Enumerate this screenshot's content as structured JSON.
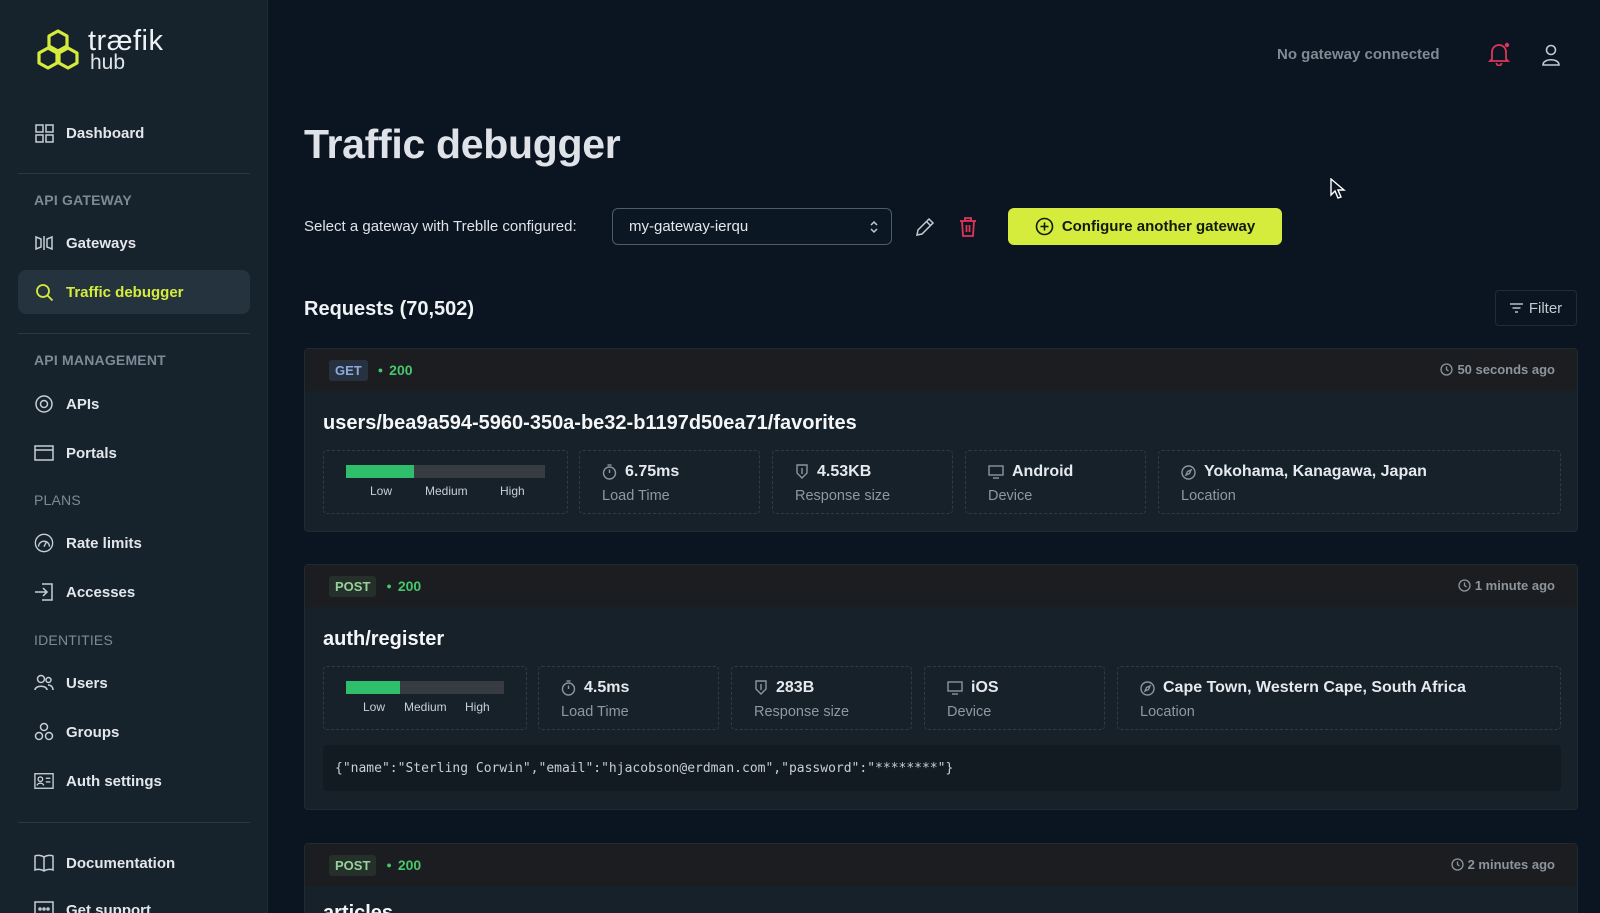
{
  "brand": {
    "name_top": "træfik",
    "name_bottom": "hub",
    "accent": "#d6ec3c"
  },
  "sidebar": {
    "dashboard": "Dashboard",
    "sec_api_gateway": "API GATEWAY",
    "gateways": "Gateways",
    "traffic_debugger": "Traffic debugger",
    "sec_api_management": "API MANAGEMENT",
    "apis": "APIs",
    "portals": "Portals",
    "sec_plans": "PLANS",
    "rate_limits": "Rate limits",
    "accesses": "Accesses",
    "sec_identities": "IDENTITIES",
    "users": "Users",
    "groups": "Groups",
    "auth_settings": "Auth settings",
    "documentation": "Documentation",
    "get_support": "Get support"
  },
  "header": {
    "gateway_status": "No gateway connected"
  },
  "page": {
    "title": "Traffic debugger",
    "gateway_label": "Select a gateway with Treblle configured:",
    "gateway_selected": "my-gateway-ierqu",
    "configure_label": "Configure another gateway",
    "requests_title": "Requests (70,502)",
    "filter_label": "Filter"
  },
  "requests": [
    {
      "method": "GET",
      "status": "200",
      "time_ago": "50 seconds ago",
      "path": "users/bea9a594-5960-350a-be32-b1197d50ea71/favorites",
      "load_level": 0.34,
      "bar_labels": [
        "Low",
        "Medium",
        "High"
      ],
      "load_time": "6.75ms",
      "load_time_label": "Load Time",
      "response_size": "4.53KB",
      "response_size_label": "Response size",
      "device": "Android",
      "device_label": "Device",
      "location": "Yokohama, Kanagawa, Japan",
      "location_label": "Location"
    },
    {
      "method": "POST",
      "status": "200",
      "time_ago": "1 minute ago",
      "path": "auth/register",
      "load_level": 0.34,
      "bar_labels": [
        "Low",
        "Medium",
        "High"
      ],
      "load_time": "4.5ms",
      "load_time_label": "Load Time",
      "response_size": "283B",
      "response_size_label": "Response size",
      "device": "iOS",
      "device_label": "Device",
      "location": "Cape Town, Western Cape, South Africa",
      "location_label": "Location",
      "payload": "{\"name\":\"Sterling Corwin\",\"email\":\"hjacobson@erdman.com\",\"password\":\"********\"}"
    },
    {
      "method": "POST",
      "status": "200",
      "time_ago": "2 minutes ago",
      "path": "articles"
    }
  ]
}
